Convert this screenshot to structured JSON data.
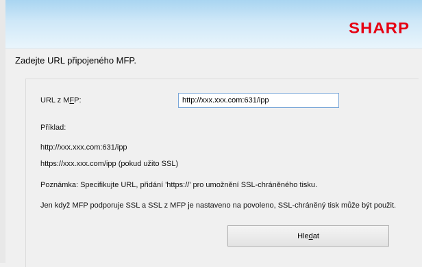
{
  "header": {
    "brand": "SHARP"
  },
  "page_title": "Zadejte URL připojeného MFP.",
  "form": {
    "url_label_pre": "URL z M",
    "url_label_ul": "F",
    "url_label_post": "P:",
    "url_value": "http://xxx.xxx.com:631/ipp",
    "example_label": "Příklad:",
    "example_1": "http://xxx.xxx.com:631/ipp",
    "example_2": "https://xxx.xxx.com/ipp (pokud užito SSL)",
    "note": "Poznámka: Specifikujte URL, přidání 'https://' pro umožnění SSL-chráněného tisku.",
    "info": "Jen když MFP podporuje SSL a SSL z MFP je nastaveno na povoleno, SSL-chráněný tisk může být použit.",
    "search_pre": "Hle",
    "search_ul": "d",
    "search_post": "at"
  }
}
